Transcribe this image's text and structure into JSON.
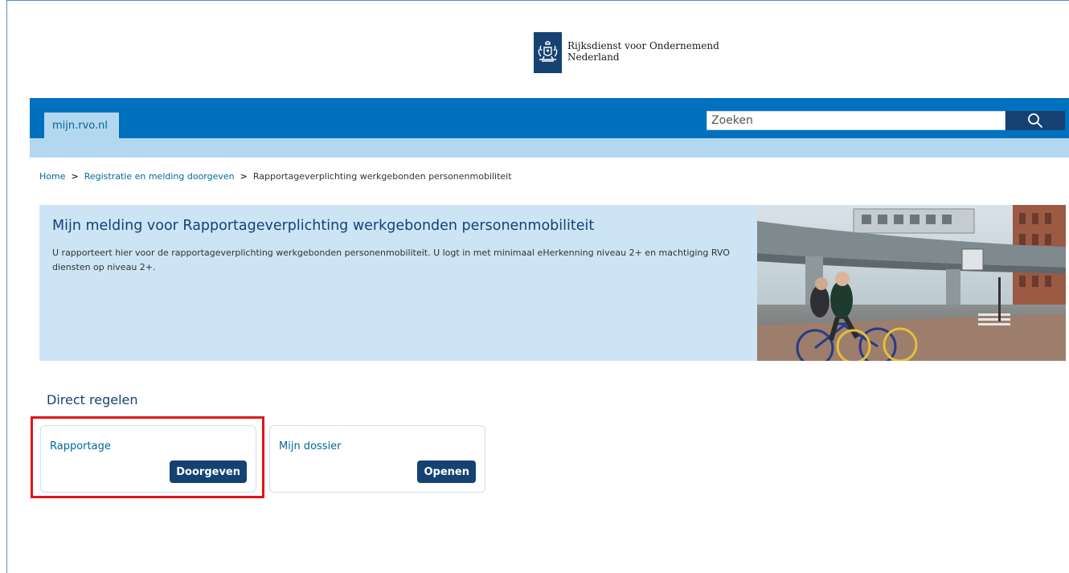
{
  "header": {
    "organization_name": "Rijksdienst voor Ondernemend\nNederland",
    "logo_icon": "coat-of-arms-icon",
    "site_tab_label": "mijn.rvo.nl",
    "search_placeholder": "Zoeken",
    "search_icon": "search-icon"
  },
  "breadcrumb": {
    "items": [
      "Home",
      "Registratie en melding doorgeven",
      "Rapportageverplichting werkgebonden personenmobiliteit"
    ],
    "separator": ">"
  },
  "hero": {
    "title": "Mijn melding voor Rapportageverplichting werkgebonden personenmobiliteit",
    "text": "U rapporteert hier voor de rapportageverplichting werkgebonden personenmobiliteit. U logt in met minimaal eHerkenning niveau 2+ en machtiging RVO diensten op niveau 2+."
  },
  "direct": {
    "heading": "Direct regelen",
    "cards": [
      {
        "title": "Rapportage",
        "button": "Doorgeven"
      },
      {
        "title": "Mijn dossier",
        "button": "Openen"
      }
    ]
  },
  "colors": {
    "brand_dark": "#154273",
    "brand_blue": "#0071bf",
    "light_blue": "#cce4f4",
    "link": "#01689b",
    "highlight": "#e3141a"
  }
}
